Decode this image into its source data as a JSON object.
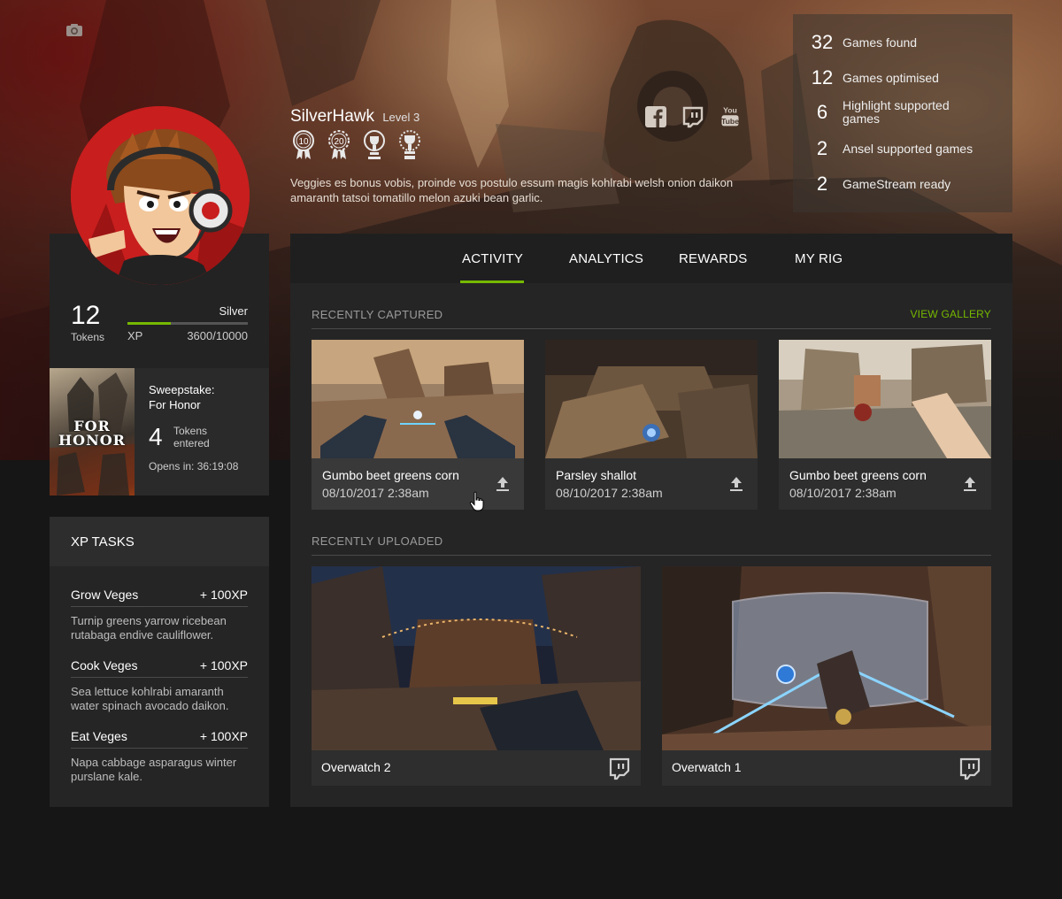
{
  "profile": {
    "username": "SilverHawk",
    "level": "Level 3",
    "bio": "Veggies es bonus vobis, proinde vos postulo essum magis kohlrabi welsh onion daikon amaranth tatsoi tomatillo melon azuki bean garlic.",
    "badges": [
      "10",
      "20",
      "",
      ""
    ],
    "socials": [
      "facebook-icon",
      "twitch-icon",
      "youtube-icon"
    ]
  },
  "stats": [
    {
      "num": "32",
      "label": "Games found"
    },
    {
      "num": "12",
      "label": "Games optimised"
    },
    {
      "num": "6",
      "label": "Highlight supported games"
    },
    {
      "num": "2",
      "label": "Ansel supported games"
    },
    {
      "num": "2",
      "label": "GameStream ready"
    }
  ],
  "tokens": {
    "count": "12",
    "label": "Tokens",
    "tier": "Silver",
    "xp_label": "XP",
    "xp_value": "3600/10000",
    "xp_progress": 0.36
  },
  "sweepstake": {
    "title_line1": "Sweepstake:",
    "title_line2": "For Honor",
    "logo_line1": "FOR",
    "logo_line2": "HONOR",
    "tokens_count": "4",
    "tokens_line1": "Tokens",
    "tokens_line2": "entered",
    "opens": "Opens in: 36:19:08"
  },
  "xp_tasks": {
    "header": "XP TASKS",
    "tasks": [
      {
        "name": "Grow Veges",
        "xp": "+ 100XP",
        "desc": "Turnip greens yarrow ricebean rutabaga endive cauliflower."
      },
      {
        "name": "Cook Veges",
        "xp": "+ 100XP",
        "desc": "Sea lettuce kohlrabi amaranth water spinach avocado daikon."
      },
      {
        "name": "Eat Veges",
        "xp": "+ 100XP",
        "desc": "Napa cabbage asparagus winter purslane kale."
      }
    ]
  },
  "tabs": [
    "ACTIVITY",
    "ANALYTICS",
    "REWARDS",
    "MY RIG"
  ],
  "active_tab": "ACTIVITY",
  "recently_captured": {
    "title": "RECENTLY CAPTURED",
    "view_gallery": "VIEW GALLERY",
    "items": [
      {
        "title": "Gumbo beet greens corn",
        "date": "08/10/2017  2:38am"
      },
      {
        "title": "Parsley shallot",
        "date": "08/10/2017  2:38am"
      },
      {
        "title": "Gumbo beet greens corn",
        "date": "08/10/2017  2:38am"
      }
    ]
  },
  "recently_uploaded": {
    "title": "RECENTLY UPLOADED",
    "items": [
      {
        "title": "Overwatch 2"
      },
      {
        "title": "Overwatch 1"
      }
    ]
  },
  "colors": {
    "accent": "#76b900",
    "panel": "#252525",
    "tabbar": "#1f1f1f"
  }
}
